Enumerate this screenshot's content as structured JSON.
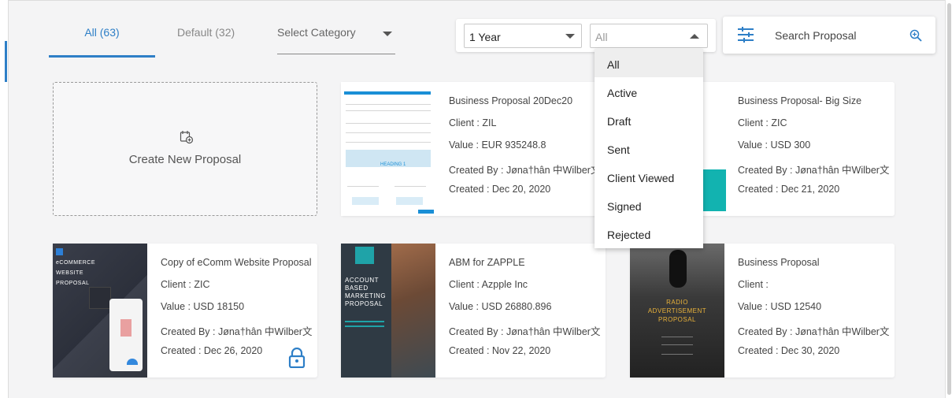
{
  "tabs": {
    "all_label": "All (63)",
    "default_label": "Default (32)",
    "category_placeholder": "Select Category"
  },
  "filters": {
    "year_value": "1 Year",
    "status_value": "All",
    "status_options": [
      "All",
      "Active",
      "Draft",
      "Sent",
      "Client Viewed",
      "Signed",
      "Rejected"
    ]
  },
  "search": {
    "label": "Search Proposal"
  },
  "create_card": {
    "label": "Create New Proposal"
  },
  "cards": [
    {
      "title": "Business Proposal 20Dec20",
      "client": "Client : ZIL",
      "value": "Value : EUR 935248.8",
      "created_by": "Created By : Jøna†hân 中Wilber文",
      "created_on": "Created : Dec 20, 2020",
      "thumb_text": "HEADING 1"
    },
    {
      "title": "Business Proposal- Big Size",
      "client": "Client : ZIC",
      "value": "Value : USD 300",
      "created_by": "Created By : Jøna†hân 中Wilber文",
      "created_on": "Created : Dec 21, 2020"
    },
    {
      "title": "Copy of eComm Website Proposal",
      "client": "Client : ZIC",
      "value": "Value : USD 18150",
      "created_by": "Created By : Jøna†hân 中Wilber文",
      "created_on": "Created : Dec 26, 2020",
      "thumb_lines": [
        "eCOMMERCE",
        "WEBSITE",
        "PROPOSAL"
      ]
    },
    {
      "title": "ABM for ZAPPLE",
      "client": "Client : Azpple Inc",
      "value": "Value : USD 26880.896",
      "created_by": "Created By : Jøna†hân 中Wilber文",
      "created_on": "Created : Nov 22, 2020",
      "thumb_lines": [
        "ACCOUNT",
        "BASED",
        "MARKETING",
        "PROPOSAL"
      ]
    },
    {
      "title": "Business Proposal",
      "client": "Client :",
      "value": "Value : USD 12540",
      "created_by": "Created By : Jøna†hân 中Wilber文",
      "created_on": "Created : Dec 30, 2020",
      "thumb_lines": [
        "RADIO",
        "ADVERTISEMENT",
        "PROPOSAL"
      ]
    }
  ],
  "colors": {
    "accent": "#2e7fc7",
    "teal": "#12b3b0",
    "background": "#f4f4f5"
  },
  "icons": {
    "filter": "sliders-icon",
    "search": "magnifier-plus-icon",
    "create": "calendar-add-icon",
    "lock": "lock-icon"
  }
}
